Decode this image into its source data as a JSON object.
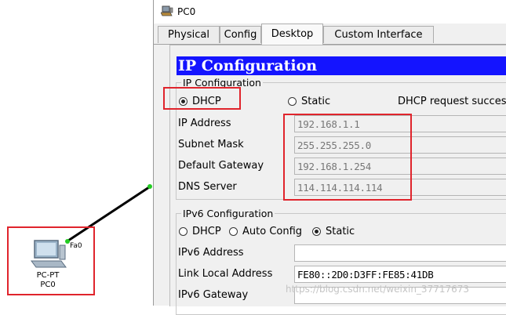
{
  "window": {
    "title": "PC0",
    "tabs": [
      {
        "label": "Physical"
      },
      {
        "label": "Config"
      },
      {
        "label": "Desktop"
      },
      {
        "label": "Custom Interface"
      }
    ]
  },
  "ip_config": {
    "header": "IP Configuration",
    "group_title": "IP Configuration",
    "dhcp_label": "DHCP",
    "static_label": "Static",
    "mode_selected": "DHCP",
    "status_text": "DHCP request succes",
    "fields": [
      {
        "label": "IP Address",
        "value": "192.168.1.1"
      },
      {
        "label": "Subnet Mask",
        "value": "255.255.255.0"
      },
      {
        "label": "Default Gateway",
        "value": "192.168.1.254"
      },
      {
        "label": "DNS Server",
        "value": "114.114.114.114"
      }
    ]
  },
  "ipv6_config": {
    "group_title": "IPv6 Configuration",
    "dhcp_label": "DHCP",
    "auto_label": "Auto Config",
    "static_label": "Static",
    "mode_selected": "Static",
    "fields": [
      {
        "label": "IPv6 Address",
        "value": ""
      },
      {
        "label": "Link Local Address",
        "value": "FE80::2D0:D3FF:FE85:41DB"
      },
      {
        "label": "IPv6 Gateway",
        "value": ""
      }
    ]
  },
  "topology": {
    "device_type": "PC-PT",
    "device_name": "PC0",
    "port_label": "Fa0"
  },
  "watermark": "https://blog.csdn.net/weixin_37717673",
  "colors": {
    "header_blue": "#1414ff",
    "highlight_red": "#e0242c",
    "link_green": "#22cc22"
  }
}
